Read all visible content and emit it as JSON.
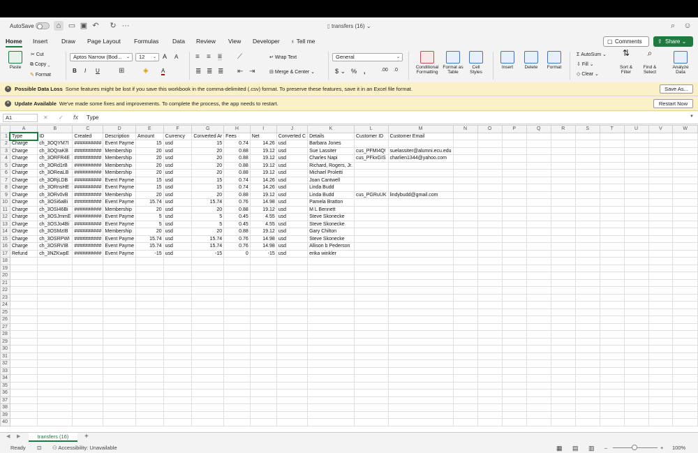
{
  "titlebar": {
    "autosave": "AutoSave",
    "doc_title": "transfers (16)"
  },
  "menu": {
    "tabs": [
      "Home",
      "Insert",
      "Draw",
      "Page Layout",
      "Formulas",
      "Data",
      "Review",
      "View",
      "Developer",
      "Tell me"
    ],
    "comments": "Comments",
    "share": "Share"
  },
  "ribbon": {
    "paste": "Paste",
    "cut": "Cut",
    "copy": "Copy",
    "format": "Format",
    "font_name": "Aptos Narrow (Bod...",
    "font_size": "12",
    "wrap_text": "Wrap Text",
    "merge_center": "Merge & Center",
    "number_format": "General",
    "conditional_formatting": "Conditional Formatting",
    "format_as_table": "Format as Table",
    "cell_styles": "Cell Styles",
    "insert": "Insert",
    "delete": "Delete",
    "format_cells": "Format",
    "autosum": "AutoSum",
    "fill": "Fill",
    "clear": "Clear",
    "sort_filter": "Sort & Filter",
    "find_select": "Find & Select",
    "analyze_data": "Analyze Data",
    "bold": "B",
    "italic": "I",
    "underline": "U",
    "grow_font": "A",
    "shrink_font": "A",
    "font_color": "A"
  },
  "messages": [
    {
      "title": "Possible Data Loss",
      "text": "Some features might be lost if you save this workbook in the comma-delimited (.csv) format. To preserve these features, save it in an Excel file format.",
      "button": "Save As..."
    },
    {
      "title": "Update Available",
      "text": "We've made some fixes and improvements. To complete the process, the app needs to restart.",
      "button": "Restart Now"
    }
  ],
  "formula_bar": {
    "cell_ref": "A1",
    "fx": "fx",
    "value": "Type"
  },
  "sheet": {
    "columns": [
      "A",
      "B",
      "C",
      "D",
      "E",
      "F",
      "G",
      "H",
      "I",
      "J",
      "K",
      "L",
      "M",
      "N",
      "O",
      "P",
      "Q",
      "R",
      "S",
      "T",
      "U",
      "V",
      "W"
    ],
    "row_count": 40,
    "rows": [
      [
        "Type",
        "ID",
        "Created",
        "Description",
        "Amount",
        "Currency",
        "Converted Ar",
        "Fees",
        "Net",
        "Converted C",
        "Details",
        "Customer ID",
        "Customer Email"
      ],
      [
        "Charge",
        "ch_3OQYM7I",
        "##########",
        "Event Payme",
        "15",
        "usd",
        "15",
        "0.74",
        "14.26",
        "usd",
        "Barbara Jones",
        "",
        ""
      ],
      [
        "Charge",
        "ch_3OQraKB",
        "##########",
        "Membership",
        "20",
        "usd",
        "20",
        "0.88",
        "19.12",
        "usd",
        "Sue Lassiter",
        "cus_PFMI4Q!",
        "suelassiter@alumni.ecu.edu"
      ],
      [
        "Charge",
        "ch_3ORFR4E",
        "##########",
        "Membership",
        "20",
        "usd",
        "20",
        "0.88",
        "19.12",
        "usd",
        "Charles Napi",
        "cus_PFkxGIS",
        "charlien1344@yahoo.com"
      ],
      [
        "Charge",
        "ch_3ORd1rB",
        "##########",
        "Membership",
        "20",
        "usd",
        "20",
        "0.88",
        "19.12",
        "usd",
        "Richard, Rogers, Jr.",
        "",
        ""
      ],
      [
        "Charge",
        "ch_3OReaLB",
        "##########",
        "Membership",
        "20",
        "usd",
        "20",
        "0.88",
        "19.12",
        "usd",
        "Michael Proletti",
        "",
        ""
      ],
      [
        "Charge",
        "ch_3ORjLDB",
        "##########",
        "Event Payme",
        "15",
        "usd",
        "15",
        "0.74",
        "14.26",
        "usd",
        "Joan Cantwell",
        "",
        ""
      ],
      [
        "Charge",
        "ch_3ORnsHE",
        "##########",
        "Event Payme",
        "15",
        "usd",
        "15",
        "0.74",
        "14.26",
        "usd",
        "Linda Budd",
        "",
        ""
      ],
      [
        "Charge",
        "ch_3ORv0vB",
        "##########",
        "Membership",
        "20",
        "usd",
        "20",
        "0.88",
        "19.12",
        "usd",
        "Linda Budd",
        "cus_PGRuUK",
        "lindybudd@gmail.com"
      ],
      [
        "Charge",
        "ch_3OSi6aBi",
        "##########",
        "Event Payme",
        "15.74",
        "usd",
        "15.74",
        "0.76",
        "14.98",
        "usd",
        "Pamela Bratton",
        "",
        ""
      ],
      [
        "Charge",
        "ch_3OSI46Bi",
        "##########",
        "Membership",
        "20",
        "usd",
        "20",
        "0.88",
        "19.12",
        "usd",
        "M L Bennett",
        "",
        ""
      ],
      [
        "Charge",
        "ch_3OSJmmE",
        "##########",
        "Event Payme",
        "5",
        "usd",
        "5",
        "0.45",
        "4.55",
        "usd",
        "Steve Skonecke",
        "",
        ""
      ],
      [
        "Charge",
        "ch_3OSJo4Bi",
        "##########",
        "Event Payme",
        "5",
        "usd",
        "5",
        "0.45",
        "4.55",
        "usd",
        "Steve Skonecke",
        "",
        ""
      ],
      [
        "Charge",
        "ch_3OSMzIB",
        "##########",
        "Membership",
        "20",
        "usd",
        "20",
        "0.88",
        "19.12",
        "usd",
        "Gary Chilton",
        "",
        ""
      ],
      [
        "Charge",
        "ch_3OSRPWI",
        "##########",
        "Event Payme",
        "15.74",
        "usd",
        "15.74",
        "0.76",
        "14.98",
        "usd",
        "Steve Skonecke",
        "",
        ""
      ],
      [
        "Charge",
        "ch_3OSRVIB",
        "##########",
        "Event Payme",
        "15.74",
        "usd",
        "15.74",
        "0.76",
        "14.98",
        "usd",
        "Allison b Pederson",
        "",
        ""
      ],
      [
        "Refund",
        "ch_3NZKwpE",
        "##########",
        "Event Payme",
        "-15",
        "usd",
        "-15",
        "0",
        "-15",
        "usd",
        "erika winkler",
        "",
        ""
      ]
    ]
  },
  "sheet_tabs": {
    "active": "transfers (16)",
    "add": "+"
  },
  "status": {
    "ready": "Ready",
    "accessibility": "Accessibility: Unavailable",
    "zoom": "100%"
  }
}
